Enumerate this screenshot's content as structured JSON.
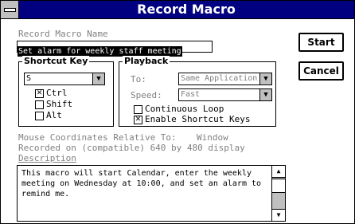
{
  "window": {
    "title": "Record Macro"
  },
  "macro_name": {
    "label": "Record Macro Name",
    "value": "Set alarm for weekly staff meeting"
  },
  "buttons": {
    "start": "Start",
    "cancel": "Cancel"
  },
  "shortcut": {
    "group_label": "Shortcut Key",
    "key": "S",
    "ctrl": {
      "label": "Ctrl",
      "checked": true
    },
    "shift": {
      "label": "Shift",
      "checked": false
    },
    "alt": {
      "label": "Alt",
      "checked": false
    }
  },
  "playback": {
    "group_label": "Playback",
    "to_label": "To:",
    "to_value": "Same Application",
    "speed_label": "Speed:",
    "speed_value": "Fast",
    "continuous_loop": {
      "label": "Continuous Loop",
      "checked": false
    },
    "enable_shortcut": {
      "label": "Enable Shortcut Keys",
      "checked": true
    }
  },
  "mouse": {
    "label": "Mouse Coordinates Relative To:",
    "value": "Window",
    "recorded": "Recorded on (compatible) 640 by 480 display"
  },
  "description": {
    "label": "Description",
    "text": "This macro will start Calendar, enter the weekly meeting on Wednesday at 10:00, and set an alarm to remind me."
  },
  "icons": {
    "system_menu": "system-menu-icon",
    "dropdown": "down-arrow-icon",
    "scroll_up": "up-arrow-icon",
    "scroll_down": "down-arrow-icon"
  }
}
